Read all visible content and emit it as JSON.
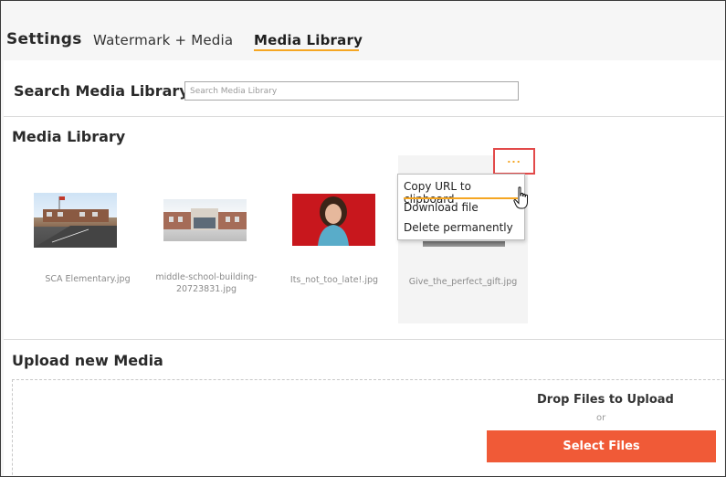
{
  "header": {
    "title": "Settings",
    "tabs": [
      {
        "label": "Watermark + Media",
        "active": false
      },
      {
        "label": "Media Library",
        "active": true
      }
    ]
  },
  "search": {
    "label": "Search Media Library",
    "placeholder": "Search Media Library",
    "value": ""
  },
  "library": {
    "title": "Media Library",
    "items": [
      {
        "file_name": "SCA Elementary.jpg",
        "thumb": "school-building-photo"
      },
      {
        "file_name": "middle-school-building-20723831.jpg",
        "thumb": "middle-school-photo"
      },
      {
        "file_name": "Its_not_too_late!.jpg",
        "thumb": "girl-portrait-photo"
      },
      {
        "file_name": "Give_the_perfect_gift.jpg",
        "thumb": "gift-photo"
      }
    ],
    "more_button": {
      "label": "...",
      "icon": "more-dots-icon"
    },
    "context_menu": {
      "items": [
        {
          "label": "Copy URL to clipboard",
          "highlighted": true
        },
        {
          "label": "Download file"
        },
        {
          "label": "Delete permanently"
        }
      ]
    }
  },
  "upload": {
    "title": "Upload new Media",
    "drop_label": "Drop Files to Upload",
    "or_label": "or",
    "select_button": "Select Files"
  },
  "colors": {
    "accent": "#f5a623",
    "primary_button": "#f05a37",
    "highlight_border": "#e24a4a"
  }
}
